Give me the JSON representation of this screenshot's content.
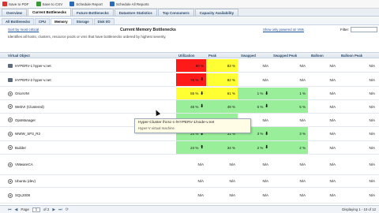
{
  "toolbar": {
    "items": [
      {
        "label": "Save to PDF",
        "icon": "pdf-icon",
        "color": "#d33"
      },
      {
        "label": "Save to CSV",
        "icon": "csv-icon",
        "color": "#3a9a3a"
      },
      {
        "label": "Schedule Report",
        "icon": "clock-icon",
        "color": "#2a6ab7"
      },
      {
        "label": "Schedule All Reports",
        "icon": "calendar-icon",
        "color": "#2a6ab7"
      }
    ]
  },
  "tabs_primary": [
    "Overview",
    "Current Bottlenecks",
    "Future Bottlenecks",
    "Datastore Statistics",
    "Top Consumers",
    "Capacity Availability"
  ],
  "tabs_secondary": [
    "All Bottlenecks",
    "CPU",
    "Memory",
    "Storage",
    "Disk I/O"
  ],
  "panel": {
    "sort_link": "Sort by most critical",
    "title": "Current Memory Bottlenecks",
    "show_only": "Show only powered on VMs",
    "filter_label": "Filter:",
    "description": "Identifies all hosts, clusters, resource pools or vms that have bottlenecks ordered by highest severity."
  },
  "columns": {
    "name": "Virtual Object",
    "util": "Utilization",
    "peak": "Peak",
    "swapped": "Swapped",
    "swapped_peak": "Swapped Peak",
    "balloon": "Balloon",
    "balloon_peak": "Balloon Peak"
  },
  "rows": [
    {
      "name": "HYPERV-1 hyper-v.net",
      "icon": "host-icon",
      "util": "80 %",
      "util_arrow": "",
      "util_color": "#ff1a1a",
      "peak": "83 %",
      "peak_color": "#ffff33",
      "swapped": "N/A",
      "swapped_color": "#ffffff",
      "swapped_peak": "N/A",
      "swapped_peak_color": "#ffffff",
      "balloon": "N/A",
      "balloon_peak": "N/A",
      "balloon_color": "#ffffff"
    },
    {
      "name": "HYPERV-2 hyper-v.net",
      "icon": "host-icon",
      "util": "78 %",
      "util_arrow": "⬇",
      "util_color": "#ff1a1a",
      "peak": "82 %",
      "peak_color": "#ffff33",
      "swapped": "N/A",
      "swapped_color": "#ffffff",
      "swapped_peak": "N/A",
      "swapped_peak_color": "#ffffff",
      "balloon": "N/A",
      "balloon_peak": "N/A",
      "balloon_color": "#ffffff"
    },
    {
      "name": "OrionVM",
      "icon": "vm-icon",
      "util": "55 %",
      "util_arrow": "⬇",
      "util_color": "#ffff33",
      "peak": "61 %",
      "peak_color": "#ffff33",
      "swapped": "1 %",
      "swapped_arrow": "⬇",
      "swapped_color": "#99ee99",
      "swapped_peak": "1 %",
      "swapped_peak_color": "#99ee99",
      "balloon": "N/A",
      "balloon_peak": "N/A",
      "balloon_color": "#ffffff"
    },
    {
      "name": "WebVI (Clustered)",
      "icon": "vm-icon",
      "util": "46 %",
      "util_arrow": "⬇",
      "util_color": "#99ee99",
      "peak": "49 %",
      "peak_color": "#99ee99",
      "swapped": "5 %",
      "swapped_arrow": "⬇",
      "swapped_color": "#99ee99",
      "swapped_peak": "5 %",
      "swapped_peak_color": "#99ee99",
      "balloon": "N/A",
      "balloon_peak": "N/A",
      "balloon_color": "#ffffff"
    },
    {
      "name": "OpsManager",
      "icon": "vm-icon",
      "util": "",
      "util_arrow": "",
      "util_color": "#99ee99",
      "peak": "",
      "peak_color": "#99ee99",
      "swapped": "N/A",
      "swapped_color": "#ffffff",
      "swapped_peak": "N/A",
      "swapped_peak_color": "#ffffff",
      "balloon": "N/A",
      "balloon_peak": "N/A",
      "balloon_color": "#ffffff"
    },
    {
      "name": "WWW_SP3_R2",
      "icon": "vm-icon",
      "util": "24 %",
      "util_arrow": "⬇",
      "util_color": "#99ee99",
      "peak": "31 %",
      "peak_color": "#99ee99",
      "swapped": "3 %",
      "swapped_arrow": "⬇",
      "swapped_color": "#99ee99",
      "swapped_peak": "3 %",
      "swapped_peak_color": "#99ee99",
      "balloon": "N/A",
      "balloon_peak": "N/A",
      "balloon_color": "#ffffff"
    },
    {
      "name": "Builder",
      "icon": "vm-icon",
      "util": "24 %",
      "util_arrow": "⬆",
      "util_color": "#99ee99",
      "peak": "34 %",
      "peak_color": "#99ee99",
      "swapped": "2 %",
      "swapped_arrow": "⬇",
      "swapped_color": "#99ee99",
      "swapped_peak": "2 %",
      "swapped_peak_color": "#99ee99",
      "balloon": "N/A",
      "balloon_peak": "N/A",
      "balloon_color": "#ffffff"
    },
    {
      "name": "VMwareCA",
      "icon": "vm-icon",
      "util": "N/A",
      "util_arrow": "",
      "util_color": "#ffffff",
      "peak": "N/A",
      "peak_color": "#ffffff",
      "swapped": "N/A",
      "swapped_color": "#ffffff",
      "swapped_peak": "N/A",
      "swapped_peak_color": "#ffffff",
      "balloon": "N/A",
      "balloon_peak": "N/A",
      "balloon_color": "#ffffff"
    },
    {
      "name": "Ubuntu (dev)",
      "icon": "vm-icon",
      "util": "N/A",
      "util_arrow": "",
      "util_color": "#ffffff",
      "peak": "N/A",
      "peak_color": "#ffffff",
      "swapped": "N/A",
      "swapped_color": "#ffffff",
      "swapped_peak": "N/A",
      "swapped_peak_color": "#ffffff",
      "balloon": "N/A",
      "balloon_peak": "N/A",
      "balloon_color": "#ffffff"
    },
    {
      "name": "SQL2008",
      "icon": "vm-icon",
      "util": "N/A",
      "util_arrow": "",
      "util_color": "#ffffff",
      "peak": "N/A",
      "peak_color": "#ffffff",
      "swapped": "N/A",
      "swapped_color": "#ffffff",
      "swapped_peak": "N/A",
      "swapped_peak_color": "#ffffff",
      "balloon": "N/A",
      "balloon_peak": "N/A",
      "balloon_color": "#ffffff"
    }
  ],
  "tooltip": {
    "line1": "Hyper-Cluster /hcsc-c-/HYPERV-1/node-v.net",
    "line2": "Hyper-V virtual machine"
  },
  "pager": {
    "page_label": "Page",
    "page_value": "1",
    "of_label": "of 2",
    "status": "Displaying 1 - 10 of 12"
  }
}
